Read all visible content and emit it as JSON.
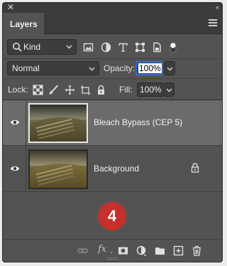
{
  "panel": {
    "title_close_glyph": "✕",
    "title_collapse_glyph": "‹‹",
    "tab_label": "Layers"
  },
  "filter": {
    "kind_value": "Kind",
    "icons": [
      "image-filter-icon",
      "adjustment-filter-icon",
      "type-filter-icon",
      "shape-filter-icon",
      "smart-object-filter-icon",
      "filter-toggle-icon"
    ]
  },
  "blend": {
    "mode_value": "Normal",
    "opacity_label": "Opacity:",
    "opacity_value": "100%"
  },
  "locks": {
    "lock_label": "Lock:",
    "fill_label": "Fill:",
    "fill_value": "100%",
    "icons": [
      "lock-transparent-pixels-icon",
      "lock-image-pixels-icon",
      "lock-position-icon",
      "lock-artboard-icon",
      "lock-all-icon"
    ]
  },
  "layers": [
    {
      "name": "Bleach Bypass (CEP 5)",
      "selected": true,
      "visible": true,
      "locked": false
    },
    {
      "name": "Background",
      "selected": false,
      "visible": true,
      "locked": true
    }
  ],
  "annotation_badge": "4",
  "colors": {
    "panel_bg": "#535353",
    "selected_layer_bg": "#6b6b6b",
    "badge_red": "#c6302a",
    "focus_blue": "#2f6fd6"
  },
  "bottom_icons": [
    "link-layers-icon",
    "fx-icon",
    "add-mask-icon",
    "new-adjustment-layer-icon",
    "new-group-icon",
    "new-layer-icon",
    "delete-layer-icon"
  ],
  "fx_label": "fx"
}
